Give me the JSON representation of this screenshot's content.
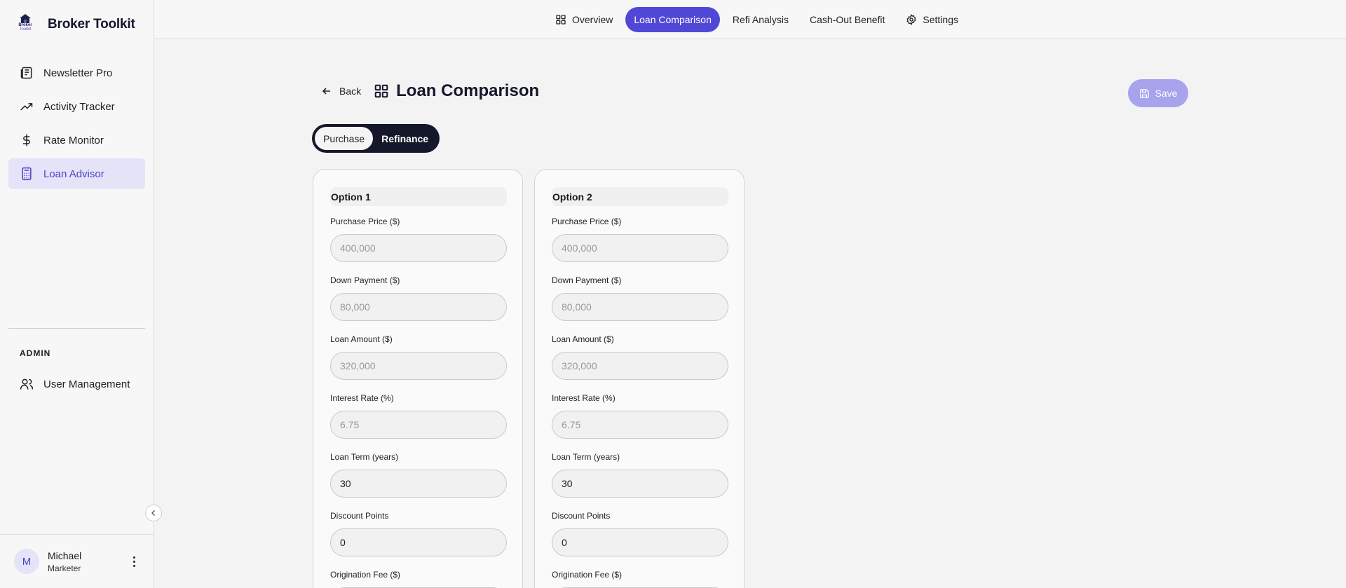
{
  "brand": {
    "name": "Broker Toolkit",
    "logo_line1": "Broker",
    "logo_line2": "Toolkit"
  },
  "sidebar": {
    "items": [
      {
        "label": "Newsletter Pro",
        "icon": "newspaper-icon"
      },
      {
        "label": "Activity Tracker",
        "icon": "trending-up-icon"
      },
      {
        "label": "Rate Monitor",
        "icon": "dollar-icon"
      },
      {
        "label": "Loan Advisor",
        "icon": "calculator-icon",
        "active": true
      }
    ],
    "admin_label": "ADMIN",
    "admin_items": [
      {
        "label": "User Management",
        "icon": "users-icon"
      }
    ]
  },
  "user": {
    "initial": "M",
    "name": "Michael",
    "role": "Marketer"
  },
  "tabs": [
    {
      "label": "Overview",
      "icon": "grid-icon"
    },
    {
      "label": "Loan Comparison",
      "active": true
    },
    {
      "label": "Refi Analysis"
    },
    {
      "label": "Cash-Out Benefit"
    },
    {
      "label": "Settings",
      "icon": "gear-icon"
    }
  ],
  "page": {
    "back_label": "Back",
    "title": "Loan Comparison",
    "save_label": "Save"
  },
  "mode_toggle": {
    "options": [
      "Purchase",
      "Refinance"
    ],
    "selected": "Purchase"
  },
  "options": [
    {
      "title": "Option 1",
      "fields": [
        {
          "label": "Purchase Price ($)",
          "placeholder": "400,000",
          "value": ""
        },
        {
          "label": "Down Payment ($)",
          "placeholder": "80,000",
          "value": ""
        },
        {
          "label": "Loan Amount ($)",
          "placeholder": "320,000",
          "value": ""
        },
        {
          "label": "Interest Rate (%)",
          "placeholder": "6.75",
          "value": ""
        },
        {
          "label": "Loan Term (years)",
          "placeholder": "",
          "value": "30"
        },
        {
          "label": "Discount Points",
          "placeholder": "",
          "value": "0"
        },
        {
          "label": "Origination Fee ($)",
          "placeholder": "",
          "value": ""
        }
      ]
    },
    {
      "title": "Option 2",
      "fields": [
        {
          "label": "Purchase Price ($)",
          "placeholder": "400,000",
          "value": ""
        },
        {
          "label": "Down Payment ($)",
          "placeholder": "80,000",
          "value": ""
        },
        {
          "label": "Loan Amount ($)",
          "placeholder": "320,000",
          "value": ""
        },
        {
          "label": "Interest Rate (%)",
          "placeholder": "6.75",
          "value": ""
        },
        {
          "label": "Loan Term (years)",
          "placeholder": "",
          "value": "30"
        },
        {
          "label": "Discount Points",
          "placeholder": "",
          "value": "0"
        },
        {
          "label": "Origination Fee ($)",
          "placeholder": "",
          "value": ""
        }
      ]
    }
  ],
  "colors": {
    "accent": "#5147d6",
    "accent_light": "#e4e3f7",
    "toggle_bg": "#15182a",
    "save_disabled": "#a7a3ed"
  }
}
